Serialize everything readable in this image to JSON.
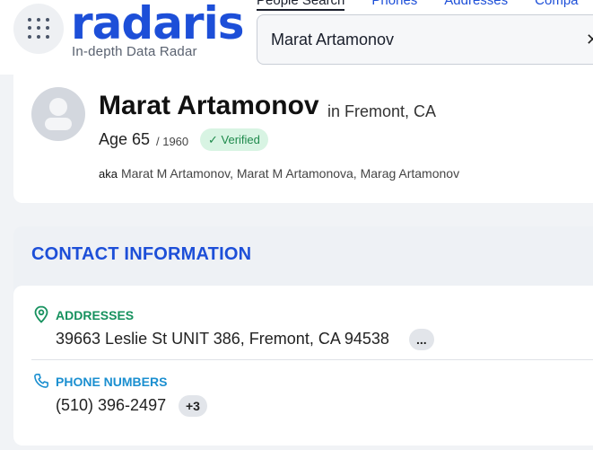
{
  "header": {
    "logo_text": "radaris",
    "tagline": "In-depth Data Radar",
    "nav": [
      "People Search",
      "Phones",
      "Addresses",
      "Compa"
    ],
    "search_value": "Marat Artamonov"
  },
  "profile": {
    "name": "Marat Artamonov",
    "location": "in Fremont, CA",
    "age": "Age 65",
    "birth_year": "/ 1960",
    "verified": "✓ Verified",
    "aka_label": "aka",
    "aka": "Marat M Artamonov, Marat M Artamonova, Marag Artamonov"
  },
  "contact": {
    "title": "CONTACT INFORMATION",
    "addresses_label": "ADDRESSES",
    "address": "39663 Leslie St UNIT 386, Fremont, CA 94538",
    "address_more": "...",
    "phones_label": "PHONE NUMBERS",
    "phone": "(510) 396-2497",
    "phone_more": "+3"
  },
  "colors": {
    "brand": "#1d4fd8",
    "addresses_accent": "#16915e",
    "phones_accent": "#1b8fd0",
    "verified_bg": "#d8f4e3"
  },
  "icons": [
    "menu-grid-icon",
    "clear-icon",
    "avatar-placeholder-icon",
    "location-pin-icon",
    "phone-icon"
  ]
}
